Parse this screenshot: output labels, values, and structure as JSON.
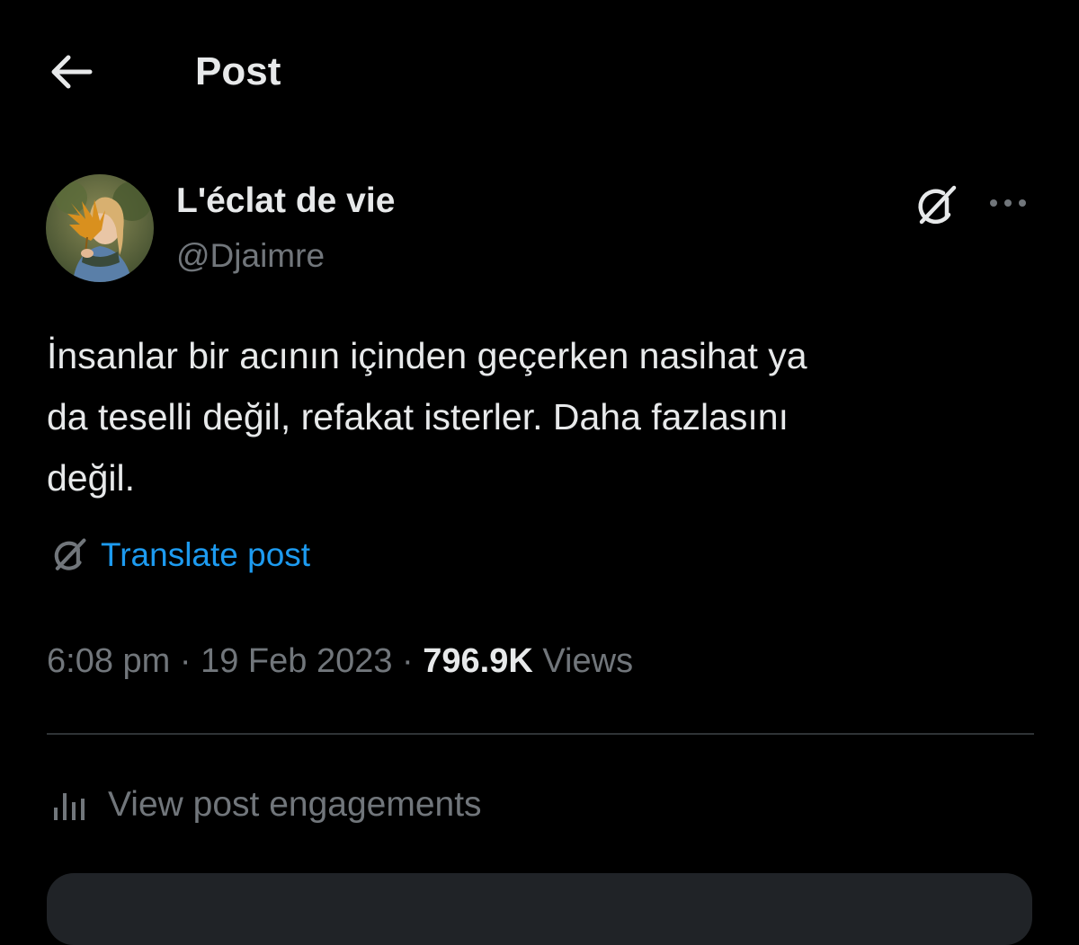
{
  "header": {
    "back_icon": "arrow-left-icon",
    "title": "Post"
  },
  "author": {
    "display_name": "L'éclat de vie",
    "handle": "@Djaimre",
    "avatar_icon": "profile-photo"
  },
  "actions": {
    "grok_icon": "grok-icon",
    "more_icon": "more-horizontal-icon"
  },
  "post": {
    "text": "İnsanlar bir acının içinden geçerken nasihat ya\nda teselli değil, refakat isterler. Daha fazlasını\ndeğil.",
    "translate_label": "Translate post",
    "translate_icon": "grok-icon"
  },
  "meta": {
    "time": "6:08 pm",
    "separator1": " · ",
    "date": "19 Feb 2023",
    "separator2": " · ",
    "views_count": "796.9K",
    "views_label": " Views"
  },
  "engagements": {
    "icon": "bar-chart-icon",
    "label": "View post engagements"
  },
  "colors": {
    "background": "#000000",
    "primary_text": "#e7e9ea",
    "secondary_text": "#71767b",
    "link": "#1d9bf0",
    "divider": "#2f3336"
  }
}
